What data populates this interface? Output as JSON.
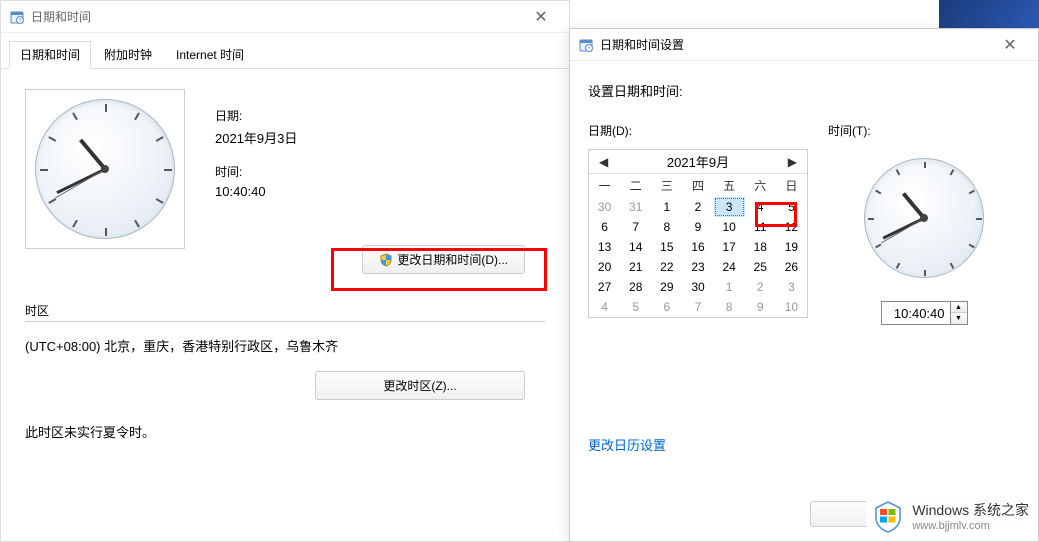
{
  "main_window": {
    "title": "日期和时间",
    "tabs": [
      {
        "label": "日期和时间",
        "active": true
      },
      {
        "label": "附加时钟",
        "active": false
      },
      {
        "label": "Internet 时间",
        "active": false
      }
    ],
    "date_label": "日期:",
    "date_value": "2021年9月3日",
    "time_label": "时间:",
    "time_value": "10:40:40",
    "change_datetime_btn": "更改日期和时间(D)...",
    "timezone_heading": "时区",
    "timezone_value": "(UTC+08:00) 北京，重庆，香港特别行政区，乌鲁木齐",
    "change_timezone_btn": "更改时区(Z)...",
    "dst_note": "此时区未实行夏令时。"
  },
  "settings_window": {
    "title": "日期和时间设置",
    "heading": "设置日期和时间:",
    "date_label": "日期(D):",
    "time_label": "时间(T):",
    "calendar": {
      "month_label": "2021年9月",
      "weekdays": [
        "一",
        "二",
        "三",
        "四",
        "五",
        "六",
        "日"
      ],
      "rows": [
        [
          {
            "d": 30,
            "o": true
          },
          {
            "d": 31,
            "o": true
          },
          {
            "d": 1
          },
          {
            "d": 2
          },
          {
            "d": 3,
            "today": true
          },
          {
            "d": 4
          },
          {
            "d": 5
          }
        ],
        [
          {
            "d": 6
          },
          {
            "d": 7
          },
          {
            "d": 8
          },
          {
            "d": 9
          },
          {
            "d": 10
          },
          {
            "d": 11
          },
          {
            "d": 12
          }
        ],
        [
          {
            "d": 13
          },
          {
            "d": 14
          },
          {
            "d": 15
          },
          {
            "d": 16
          },
          {
            "d": 17
          },
          {
            "d": 18
          },
          {
            "d": 19
          }
        ],
        [
          {
            "d": 20
          },
          {
            "d": 21
          },
          {
            "d": 22
          },
          {
            "d": 23
          },
          {
            "d": 24
          },
          {
            "d": 25
          },
          {
            "d": 26
          }
        ],
        [
          {
            "d": 27
          },
          {
            "d": 28
          },
          {
            "d": 29
          },
          {
            "d": 30
          },
          {
            "d": 1,
            "o": true
          },
          {
            "d": 2,
            "o": true
          },
          {
            "d": 3,
            "o": true
          }
        ],
        [
          {
            "d": 4,
            "o": true
          },
          {
            "d": 5,
            "o": true
          },
          {
            "d": 6,
            "o": true
          },
          {
            "d": 7,
            "o": true
          },
          {
            "d": 8,
            "o": true
          },
          {
            "d": 9,
            "o": true
          },
          {
            "d": 10,
            "o": true
          }
        ]
      ]
    },
    "time_input": "10:40:40",
    "calendar_settings_link": "更改日历设置"
  },
  "watermark": {
    "line1": "Windows 系统之家",
    "line2": "www.bjjmlv.com"
  }
}
